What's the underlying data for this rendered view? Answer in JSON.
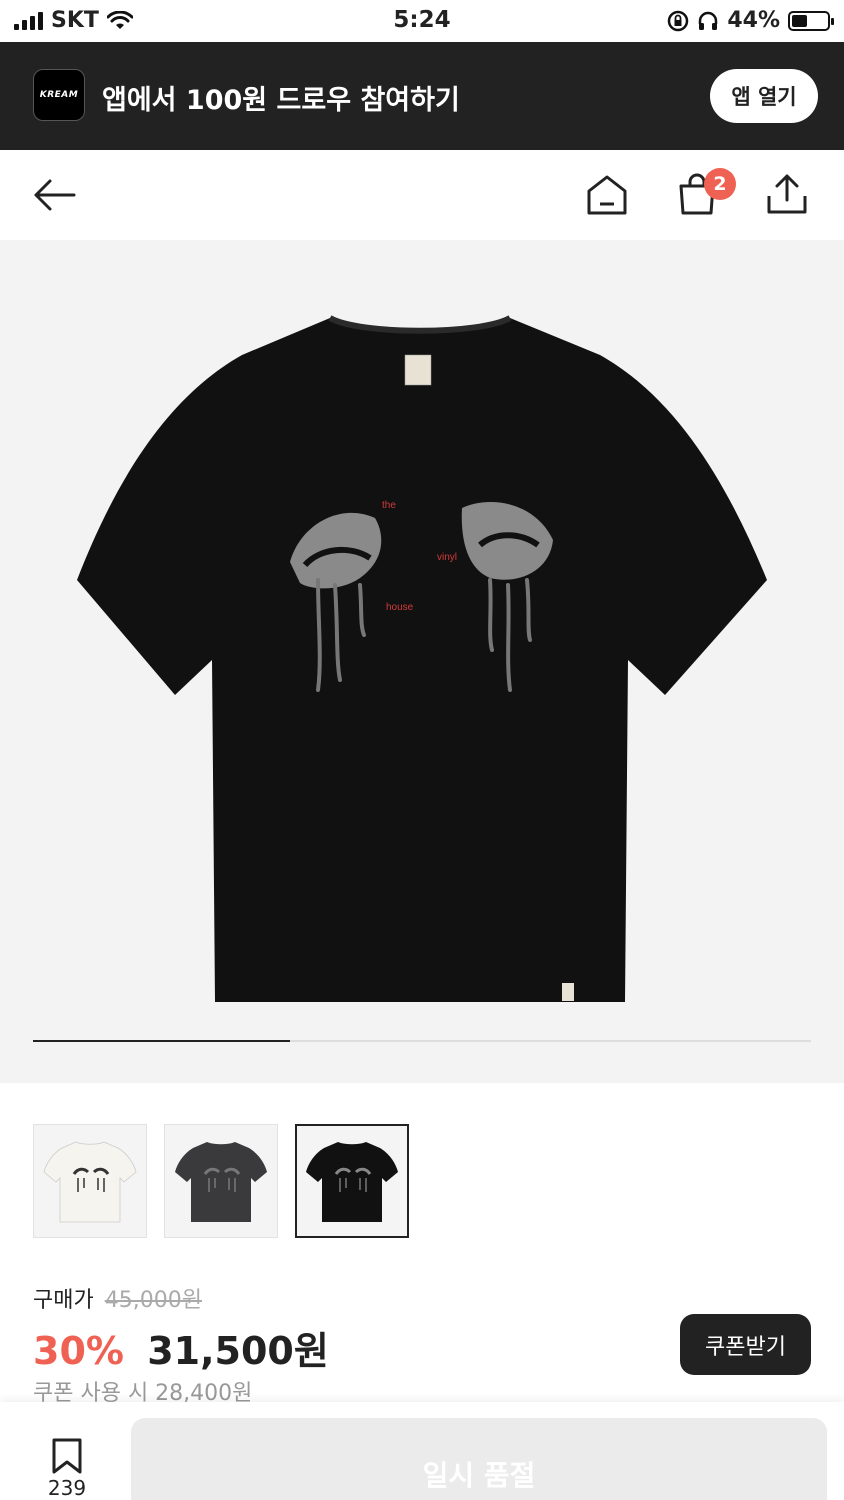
{
  "status_bar": {
    "carrier": "SKT",
    "time": "5:24",
    "battery": "44%",
    "battery_level": 0.44
  },
  "banner": {
    "logo_text": "KREAM",
    "text": "앱에서 100원 드로우 참여하기",
    "open_button": "앱 열기"
  },
  "nav": {
    "cart_count": "2"
  },
  "hero": {
    "print_words": [
      "the",
      "vinyl",
      "house"
    ],
    "progress": 0.33,
    "colors": {
      "background": "#f3f3f3",
      "shirt": "#111111",
      "print_gray": "#8a8a8a",
      "print_red": "#d23b3b"
    }
  },
  "thumbnails": [
    {
      "variant": "white",
      "color": "#f5f4ee",
      "selected": false
    },
    {
      "variant": "charcoal",
      "color": "#3a3a3c",
      "selected": false
    },
    {
      "variant": "black",
      "color": "#111111",
      "selected": true
    }
  ],
  "price": {
    "label": "구매가",
    "original": "45,000원",
    "discount": "30%",
    "sale": "31,500원",
    "coupon_text": "쿠폰 사용 시 28,400원",
    "coupon_button": "쿠폰받기"
  },
  "bottom": {
    "wish_count": "239",
    "soldout_button": "일시 품절"
  },
  "accent_color": "#ef6253"
}
